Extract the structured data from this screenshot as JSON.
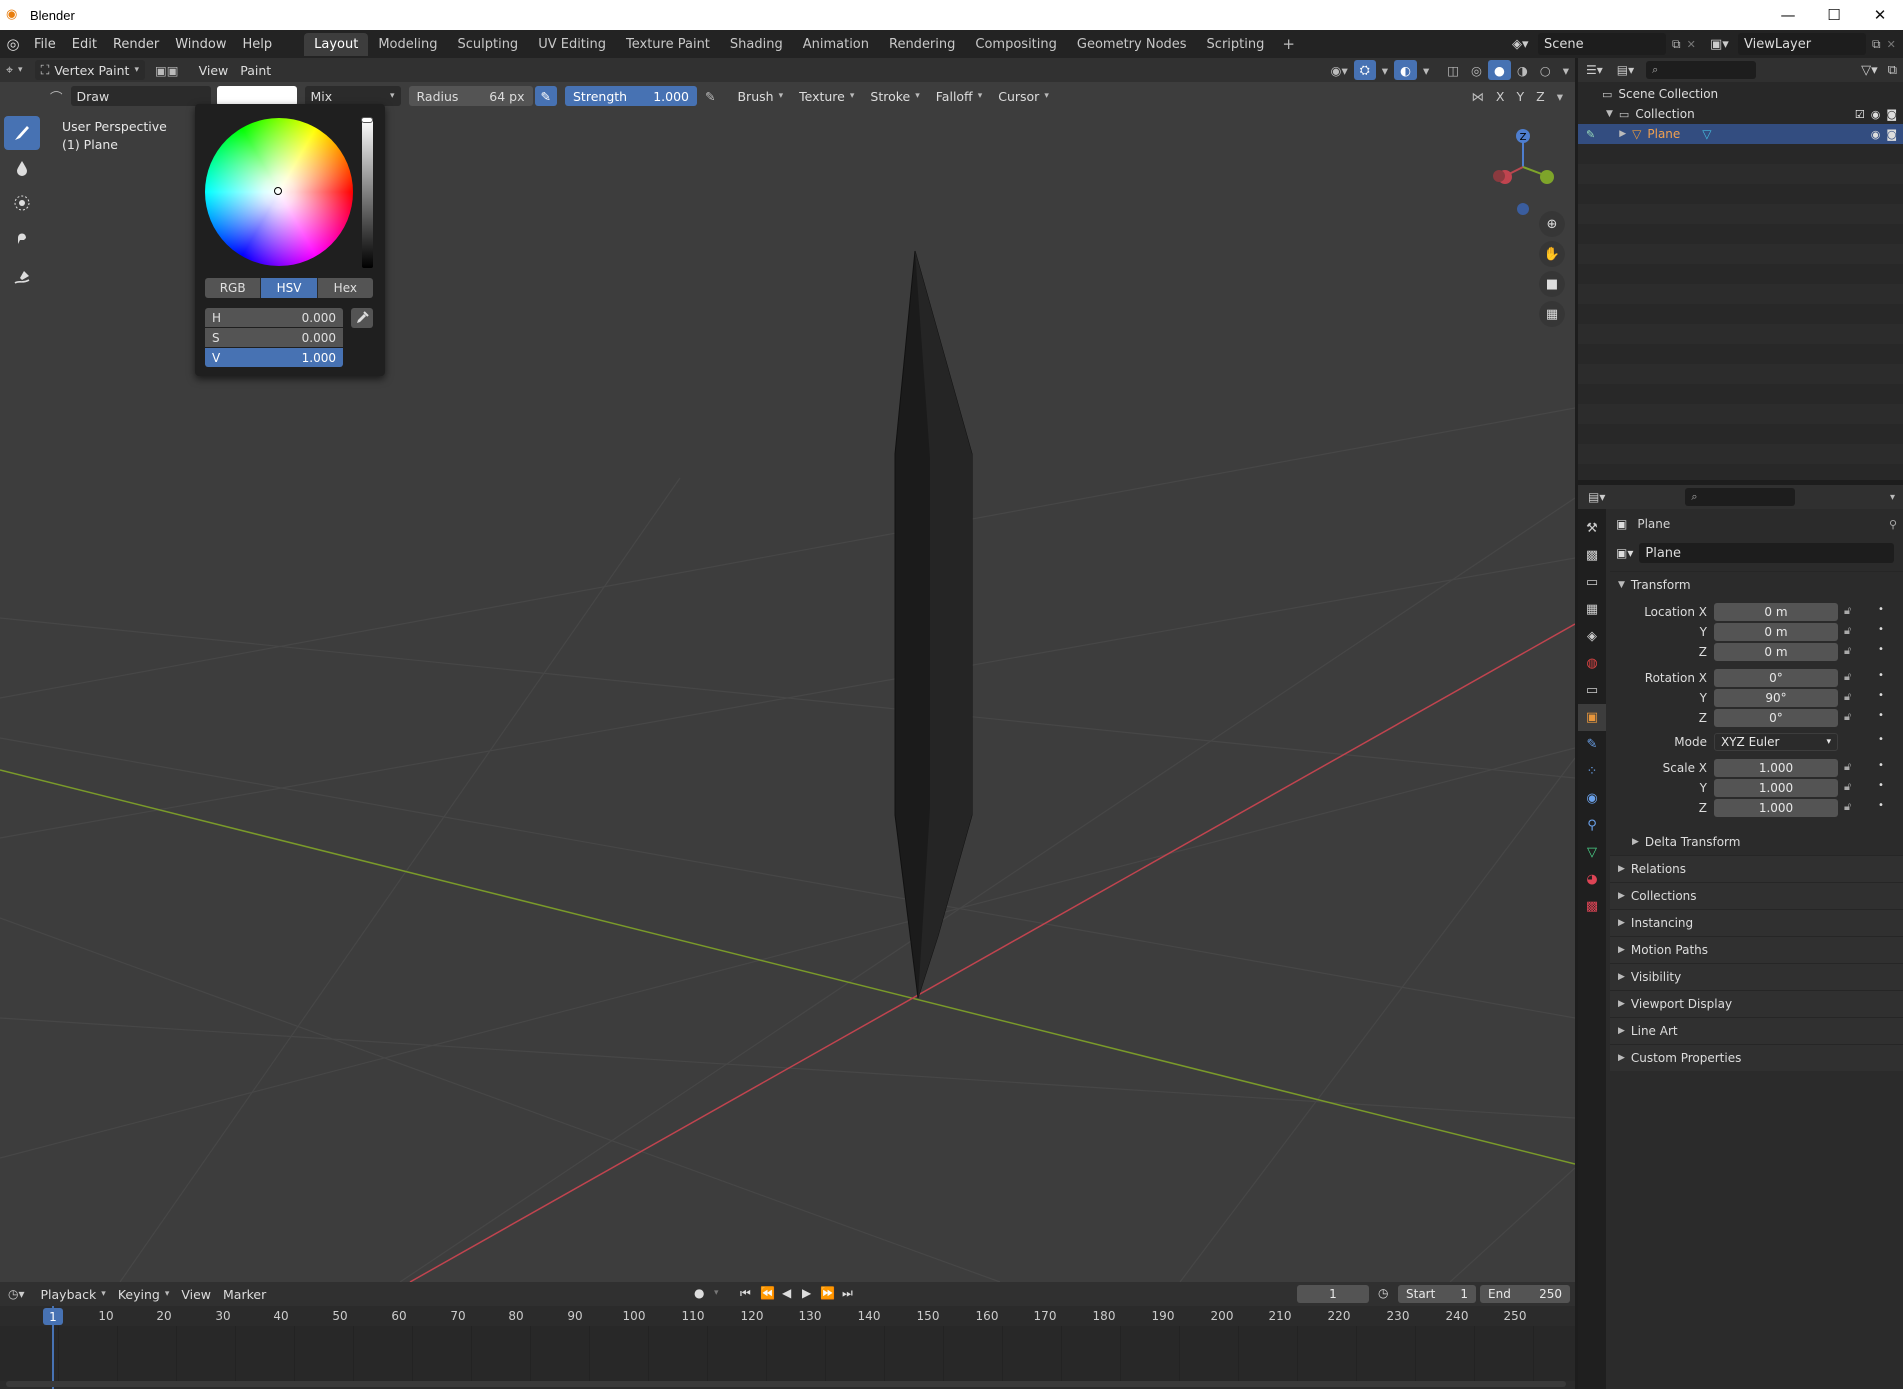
{
  "window": {
    "title": "Blender",
    "minimize": "—",
    "maximize": "☐",
    "close": "✕"
  },
  "menu": [
    "File",
    "Edit",
    "Render",
    "Window",
    "Help"
  ],
  "workspaces": [
    "Layout",
    "Modeling",
    "Sculpting",
    "UV Editing",
    "Texture Paint",
    "Shading",
    "Animation",
    "Rendering",
    "Compositing",
    "Geometry Nodes",
    "Scripting"
  ],
  "active_workspace": "Layout",
  "scene": "Scene",
  "view_layer": "ViewLayer",
  "viewport_header": {
    "mode": "Vertex Paint",
    "view": "View",
    "paint": "Paint"
  },
  "tool_header": {
    "brush": "Draw",
    "blend": "Mix",
    "radius_label": "Radius",
    "radius_value": "64 px",
    "strength_label": "Strength",
    "strength_value": "1.000",
    "brush_menu": "Brush",
    "texture_menu": "Texture",
    "stroke_menu": "Stroke",
    "falloff_menu": "Falloff",
    "cursor_menu": "Cursor",
    "axes": [
      "X",
      "Y",
      "Z"
    ]
  },
  "viewport_info": {
    "perspective": "User Perspective",
    "object": "(1) Plane"
  },
  "color_picker": {
    "modes": [
      "RGB",
      "HSV",
      "Hex"
    ],
    "active_mode": "HSV",
    "fields": [
      {
        "label": "H",
        "value": "0.000"
      },
      {
        "label": "S",
        "value": "0.000"
      },
      {
        "label": "V",
        "value": "1.000"
      }
    ],
    "current_color": "#ffffff"
  },
  "gizmo": {
    "axis_label": "Z"
  },
  "outliner": {
    "scene_collection": "Scene Collection",
    "collection": "Collection",
    "object": "Plane"
  },
  "properties": {
    "context": "Plane",
    "object_name": "Plane",
    "transform_title": "Transform",
    "location": {
      "x_label": "Location X",
      "y_label": "Y",
      "z_label": "Z",
      "x": "0 m",
      "y": "0 m",
      "z": "0 m"
    },
    "rotation": {
      "x_label": "Rotation X",
      "y_label": "Y",
      "z_label": "Z",
      "x": "0°",
      "y": "90°",
      "z": "0°"
    },
    "mode_label": "Mode",
    "mode_value": "XYZ Euler",
    "scale": {
      "x_label": "Scale X",
      "y_label": "Y",
      "z_label": "Z",
      "x": "1.000",
      "y": "1.000",
      "z": "1.000"
    },
    "delta_transform": "Delta Transform",
    "panels": [
      "Relations",
      "Collections",
      "Instancing",
      "Motion Paths",
      "Visibility",
      "Viewport Display",
      "Line Art",
      "Custom Properties"
    ]
  },
  "timeline": {
    "menus": [
      "Playback",
      "Keying",
      "View",
      "Marker"
    ],
    "current_frame": "1",
    "start_label": "Start",
    "start_value": "1",
    "end_label": "End",
    "end_value": "250",
    "ticks": [
      "10",
      "20",
      "30",
      "40",
      "50",
      "60",
      "70",
      "80",
      "90",
      "100",
      "110",
      "120",
      "130",
      "140",
      "150",
      "160",
      "170",
      "180",
      "190",
      "200",
      "210",
      "220",
      "230",
      "240",
      "250"
    ],
    "playhead": "1"
  },
  "colors": {
    "accent": "#4772b3",
    "x_axis": "#c0444f",
    "y_axis": "#7a9a2a",
    "viewport_bg": "#3d3d3d"
  }
}
